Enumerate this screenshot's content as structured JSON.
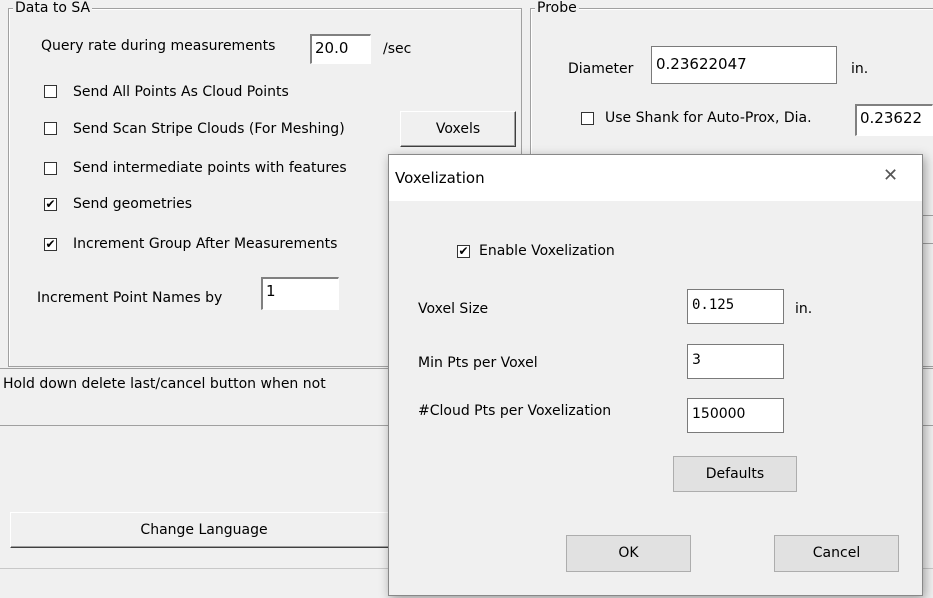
{
  "data_to_sa": {
    "title": "Data to SA",
    "query_rate_label": "Query rate during measurements",
    "query_rate_value": "20.0",
    "query_rate_unit": "/sec",
    "send_all_points_label": "Send All Points As Cloud Points",
    "send_all_points_checked": false,
    "send_scan_stripe_label": "Send Scan Stripe Clouds (For Meshing)",
    "send_scan_stripe_checked": false,
    "voxels_button": "Voxels",
    "send_intermediate_label": "Send intermediate points with features",
    "send_intermediate_checked": false,
    "send_geometries_label": "Send geometries",
    "send_geometries_checked": true,
    "increment_group_label": "Increment Group After Measurements",
    "increment_group_checked": true,
    "increment_point_names_label": "Increment Point Names by",
    "increment_point_names_value": "1"
  },
  "hold_down_text": "Hold down delete last/cancel button when not",
  "change_language_button": "Change Language",
  "probe": {
    "title": "Probe",
    "diameter_label": "Diameter",
    "diameter_value": "0.23622047",
    "diameter_unit": "in.",
    "use_shank_label": "Use Shank for Auto-Prox, Dia.",
    "use_shank_checked": false,
    "use_shank_value": "0.23622"
  },
  "dialog": {
    "title": "Voxelization",
    "close_glyph": "✕",
    "enable_label": "Enable Voxelization",
    "enable_checked": true,
    "voxel_size_label": "Voxel Size",
    "voxel_size_value": "0.125",
    "voxel_size_unit": "in.",
    "min_pts_label": "Min Pts per Voxel",
    "min_pts_value": "3",
    "cloud_pts_label": "#Cloud Pts per Voxelization",
    "cloud_pts_value": "150000",
    "defaults_button": "Defaults",
    "ok_button": "OK",
    "cancel_button": "Cancel"
  },
  "check_glyph": "✔"
}
